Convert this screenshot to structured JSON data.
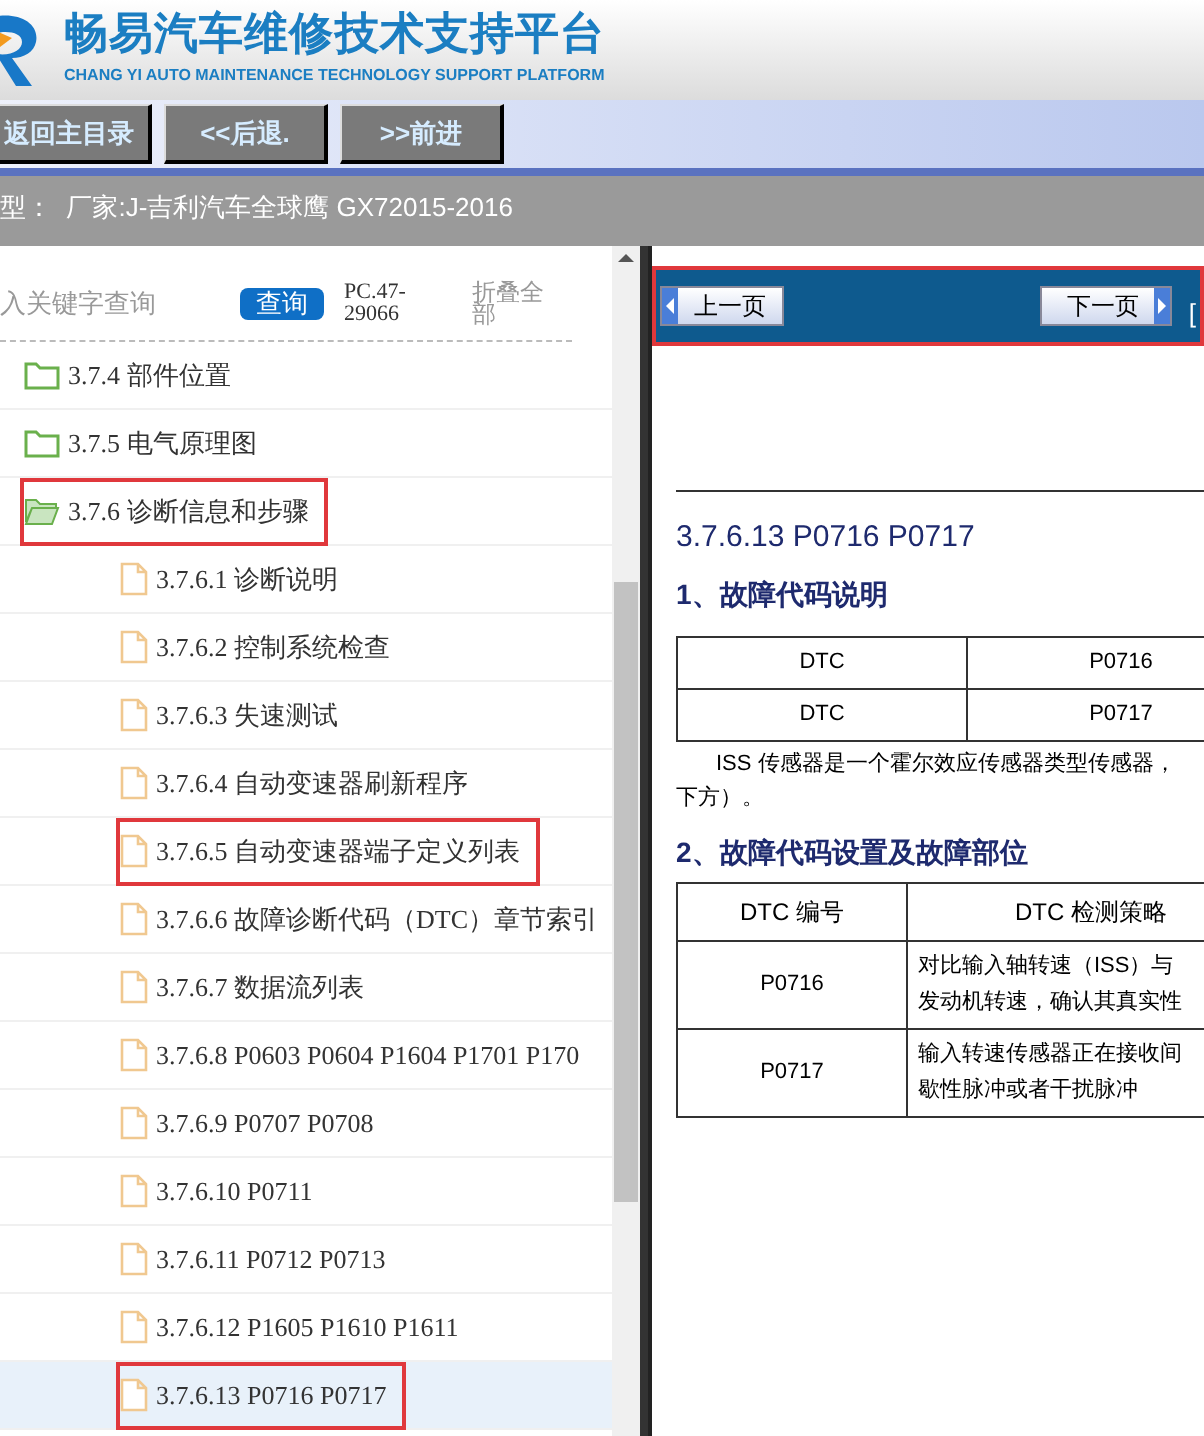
{
  "header": {
    "title": "畅易汽车维修技术支持平台",
    "subtitle": "CHANG YI AUTO MAINTENANCE TECHNOLOGY SUPPORT PLATFORM"
  },
  "nav_buttons": [
    "返回主目录",
    "<<后退.",
    ">>前进"
  ],
  "model_bar": {
    "text": "型：  厂家:J-吉利汽车全球鹰 GX72015-2016"
  },
  "search": {
    "placeholder": "入关键字查询",
    "button": "查询",
    "code": "PC.47-29066",
    "collapse": "折叠全部"
  },
  "tree": [
    {
      "label": "3.7.4 部件位置",
      "kind": "folder",
      "expanded": false,
      "selected": false,
      "highlighted": false
    },
    {
      "label": "3.7.5 电气原理图",
      "kind": "folder",
      "expanded": false,
      "selected": false,
      "highlighted": false
    },
    {
      "label": "3.7.6 诊断信息和步骤",
      "kind": "folder",
      "expanded": true,
      "selected": false,
      "highlighted": true,
      "children": [
        {
          "label": "3.7.6.1 诊断说明",
          "kind": "file",
          "selected": false,
          "highlighted": false
        },
        {
          "label": "3.7.6.2 控制系统检查",
          "kind": "file",
          "selected": false,
          "highlighted": false
        },
        {
          "label": "3.7.6.3 失速测试",
          "kind": "file",
          "selected": false,
          "highlighted": false
        },
        {
          "label": "3.7.6.4 自动变速器刷新程序",
          "kind": "file",
          "selected": false,
          "highlighted": false
        },
        {
          "label": "3.7.6.5 自动变速器端子定义列表",
          "kind": "file",
          "selected": false,
          "highlighted": true
        },
        {
          "label": "3.7.6.6 故障诊断代码（DTC）章节索引",
          "kind": "file",
          "selected": false,
          "highlighted": false
        },
        {
          "label": "3.7.6.7 数据流列表",
          "kind": "file",
          "selected": false,
          "highlighted": false
        },
        {
          "label": "3.7.6.8 P0603 P0604 P1604 P1701 P170",
          "kind": "file",
          "selected": false,
          "highlighted": false
        },
        {
          "label": "3.7.6.9 P0707 P0708",
          "kind": "file",
          "selected": false,
          "highlighted": false
        },
        {
          "label": "3.7.6.10 P0711",
          "kind": "file",
          "selected": false,
          "highlighted": false
        },
        {
          "label": "3.7.6.11 P0712 P0713",
          "kind": "file",
          "selected": false,
          "highlighted": false
        },
        {
          "label": "3.7.6.12 P1605 P1610 P1611",
          "kind": "file",
          "selected": false,
          "highlighted": false
        },
        {
          "label": "3.7.6.13 P0716 P0717",
          "kind": "file",
          "selected": true,
          "highlighted": true
        }
      ]
    }
  ],
  "pager": {
    "prev": "上一页",
    "next": "下一页",
    "extra": "[",
    "highlighted": true
  },
  "document": {
    "title": "3.7.6.13 P0716  P0717",
    "heading_1": "1、故障代码说明",
    "table_1": [
      [
        "DTC",
        "P0716"
      ],
      [
        "DTC",
        "P0717"
      ]
    ],
    "paragraph": [
      "ISS 传感器是一个霍尔效应传感器类型传感器，",
      "下方）。"
    ],
    "heading_2": "2、故障代码设置及故障部位",
    "table_2": {
      "columns": [
        "DTC 编号",
        "DTC 检测策略"
      ],
      "rows": [
        [
          "P0716",
          [
            "对比输入轴转速（ISS）与",
            "发动机转速，确认其真实性"
          ]
        ],
        [
          "P0717",
          [
            "输入转速传感器正在接收间",
            "歇性脉冲或者干扰脉冲"
          ]
        ]
      ]
    }
  }
}
